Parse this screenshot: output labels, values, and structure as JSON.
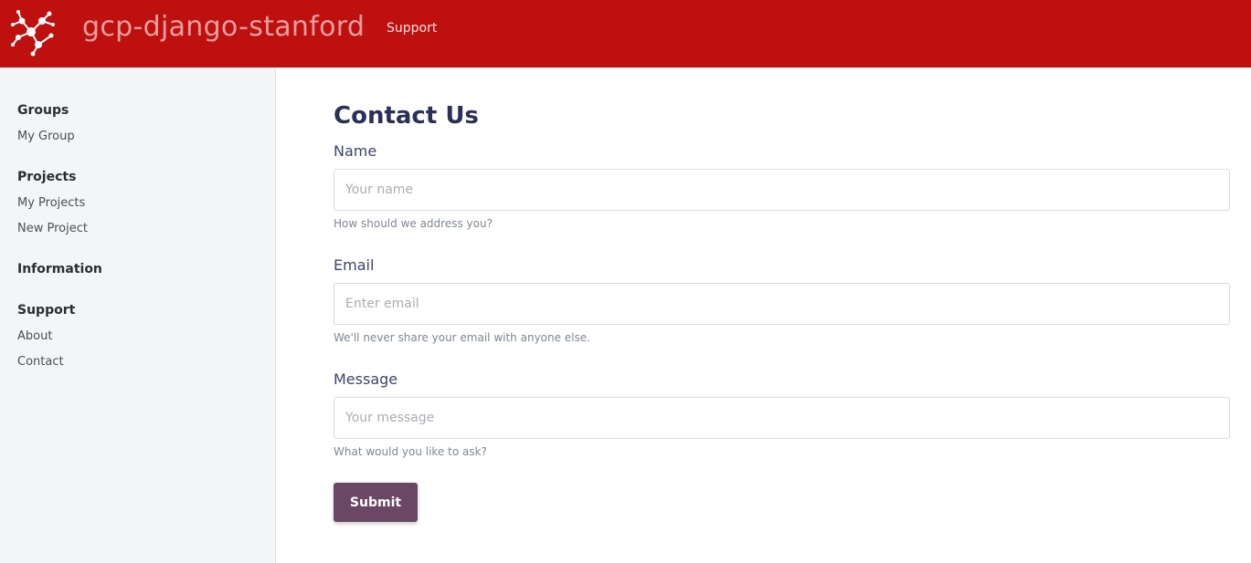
{
  "header": {
    "app_title": "gcp-django-stanford",
    "nav_link": "Support",
    "logo_icon": "molecule-network-icon",
    "bg_color": "#bf1010"
  },
  "sidebar": {
    "sections": [
      {
        "heading": "Groups",
        "links": [
          "My Group"
        ]
      },
      {
        "heading": "Projects",
        "links": [
          "My Projects",
          "New Project"
        ]
      },
      {
        "heading": "Information",
        "links": []
      },
      {
        "heading": "Support",
        "links": [
          "About",
          "Contact"
        ]
      }
    ]
  },
  "form": {
    "title": "Contact Us",
    "name": {
      "label": "Name",
      "placeholder": "Your name",
      "value": "",
      "help": "How should we address you?"
    },
    "email": {
      "label": "Email",
      "placeholder": "Enter email",
      "value": "",
      "help": "We'll never share your email with anyone else."
    },
    "message": {
      "label": "Message",
      "placeholder": "Your message",
      "value": "",
      "help": "What would you like to ask?"
    },
    "submit_label": "Submit",
    "submit_color": "#6b4766"
  }
}
